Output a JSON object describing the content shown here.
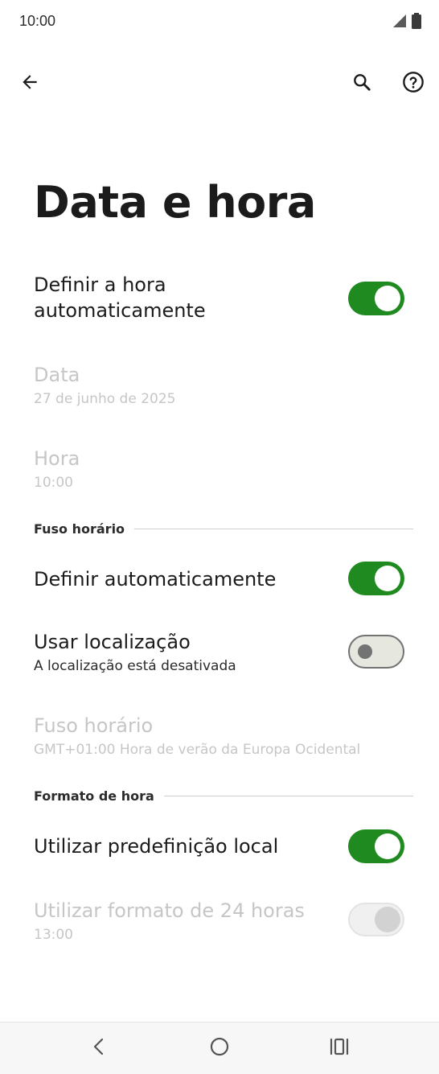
{
  "status_bar": {
    "time": "10:00",
    "icons": [
      "signal-icon",
      "battery-icon"
    ]
  },
  "app_bar": {
    "icons": [
      "back-arrow-icon",
      "search-icon",
      "help-icon"
    ]
  },
  "page": {
    "title": "Data e hora"
  },
  "settings": {
    "auto_time": {
      "title_line1": "Definir a hora",
      "title_line2": "automaticamente",
      "enabled": true
    },
    "date": {
      "title": "Data",
      "value": "27 de junho de 2025",
      "disabled": true
    },
    "time": {
      "title": "Hora",
      "value": "10:00",
      "disabled": true
    },
    "timezone_section": {
      "label": "Fuso horário"
    },
    "auto_timezone": {
      "title": "Definir automaticamente",
      "enabled": true
    },
    "use_location": {
      "title": "Usar localização",
      "subtitle": "A localização está desativada",
      "enabled": false
    },
    "timezone": {
      "title": "Fuso horário",
      "value": "GMT+01:00 Hora de verão da Europa Ocidental",
      "disabled": true
    },
    "time_format_section": {
      "label": "Formato de hora"
    },
    "locale_default": {
      "title": "Utilizar predefinição local",
      "enabled": true
    },
    "format_24h": {
      "title": "Utilizar formato de 24 horas",
      "value": "13:00",
      "enabled": true,
      "disabled": true
    }
  },
  "nav_bar": {
    "icons": [
      "nav-back-icon",
      "nav-home-icon",
      "nav-recents-icon"
    ]
  },
  "colors": {
    "toggle_on": "#1f8a1f",
    "toggle_off_bg": "#e6e8e0",
    "disabled_text": "#c6c6c6",
    "primary_text": "#1b1b1b"
  }
}
